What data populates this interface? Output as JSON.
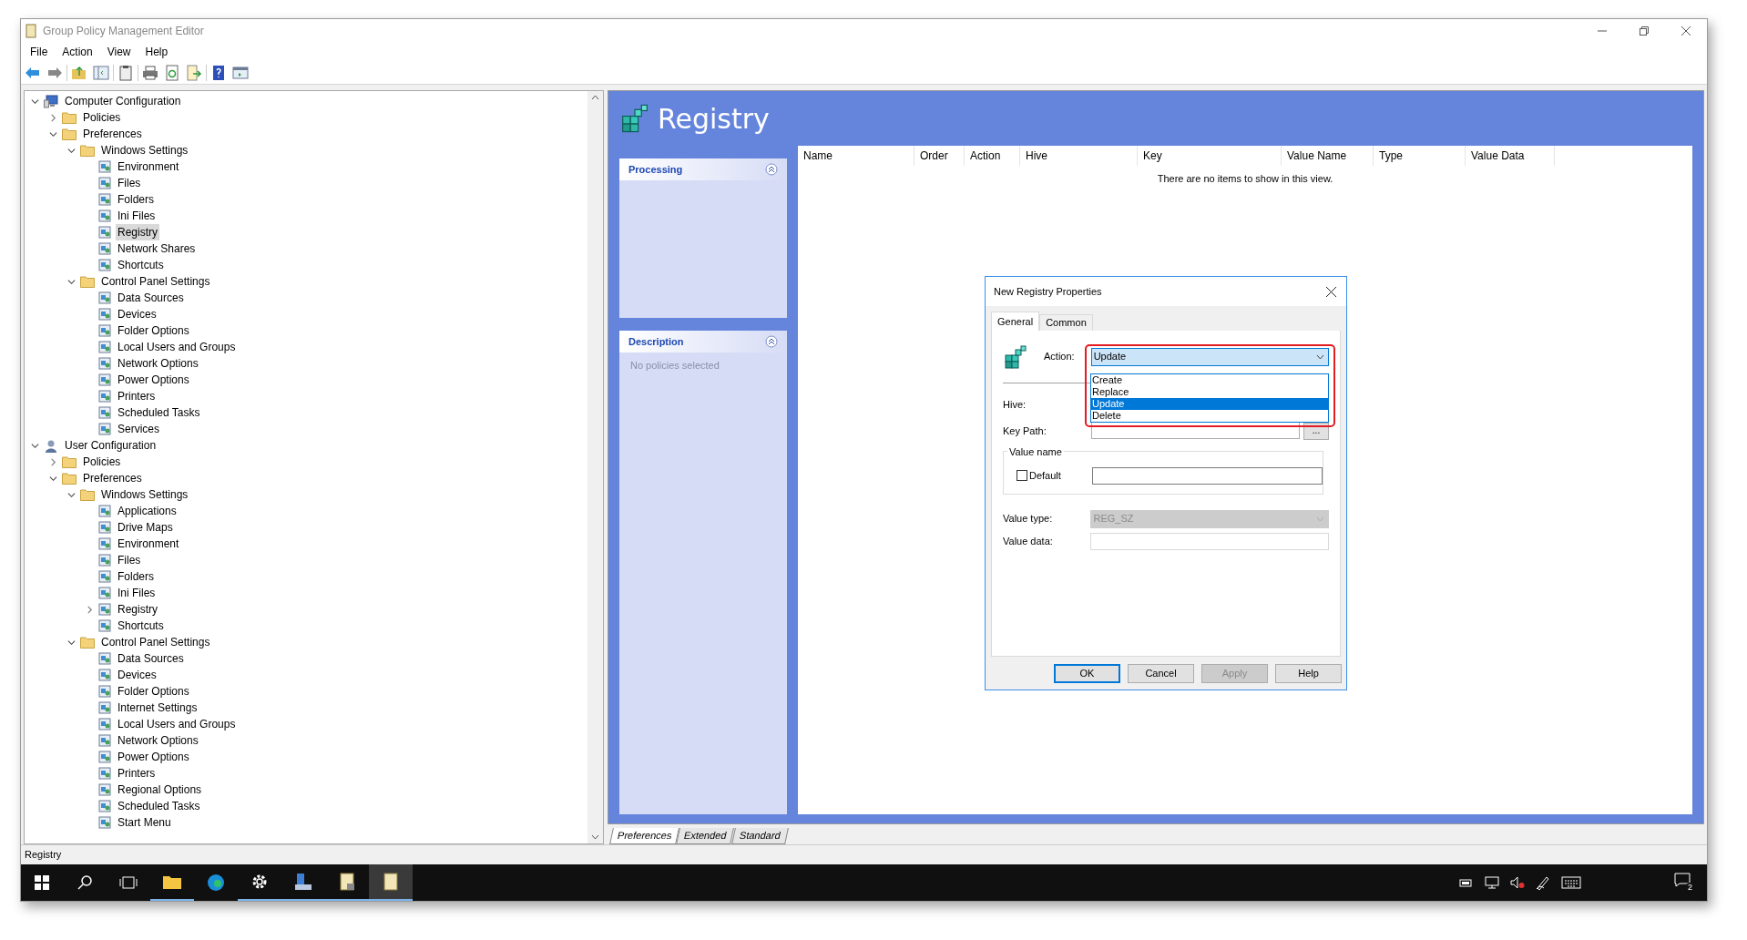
{
  "window": {
    "title": "Group Policy Management Editor"
  },
  "menu": [
    "File",
    "Action",
    "View",
    "Help"
  ],
  "tree": [
    {
      "label": "Computer Configuration",
      "expanded": true,
      "selected": false,
      "children": [
        {
          "label": "Policies",
          "expanded": false,
          "selected": false
        },
        {
          "label": "Preferences",
          "expanded": true,
          "selected": false,
          "children": [
            {
              "label": "Windows Settings",
              "expanded": true,
              "selected": false,
              "children": [
                {
                  "label": "Environment",
                  "selected": false
                },
                {
                  "label": "Files",
                  "selected": false
                },
                {
                  "label": "Folders",
                  "selected": false
                },
                {
                  "label": "Ini Files",
                  "selected": false
                },
                {
                  "label": "Registry",
                  "selected": true
                },
                {
                  "label": "Network Shares",
                  "selected": false
                },
                {
                  "label": "Shortcuts",
                  "selected": false
                }
              ]
            },
            {
              "label": "Control Panel Settings",
              "expanded": true,
              "selected": false,
              "children": [
                {
                  "label": "Data Sources",
                  "selected": false
                },
                {
                  "label": "Devices",
                  "selected": false
                },
                {
                  "label": "Folder Options",
                  "selected": false
                },
                {
                  "label": "Local Users and Groups",
                  "selected": false
                },
                {
                  "label": "Network Options",
                  "selected": false
                },
                {
                  "label": "Power Options",
                  "selected": false
                },
                {
                  "label": "Printers",
                  "selected": false
                },
                {
                  "label": "Scheduled Tasks",
                  "selected": false
                },
                {
                  "label": "Services",
                  "selected": false
                }
              ]
            }
          ]
        }
      ]
    },
    {
      "label": "User Configuration",
      "expanded": true,
      "selected": false,
      "children": [
        {
          "label": "Policies",
          "expanded": false,
          "selected": false
        },
        {
          "label": "Preferences",
          "expanded": true,
          "selected": false,
          "children": [
            {
              "label": "Windows Settings",
              "expanded": true,
              "selected": false,
              "children": [
                {
                  "label": "Applications",
                  "selected": false
                },
                {
                  "label": "Drive Maps",
                  "selected": false
                },
                {
                  "label": "Environment",
                  "selected": false
                },
                {
                  "label": "Files",
                  "selected": false
                },
                {
                  "label": "Folders",
                  "selected": false
                },
                {
                  "label": "Ini Files",
                  "selected": false
                },
                {
                  "label": "Registry",
                  "expanded": false,
                  "selected": false
                },
                {
                  "label": "Shortcuts",
                  "selected": false
                }
              ]
            },
            {
              "label": "Control Panel Settings",
              "expanded": true,
              "selected": false,
              "children": [
                {
                  "label": "Data Sources",
                  "selected": false
                },
                {
                  "label": "Devices",
                  "selected": false
                },
                {
                  "label": "Folder Options",
                  "selected": false
                },
                {
                  "label": "Internet Settings",
                  "selected": false
                },
                {
                  "label": "Local Users and Groups",
                  "selected": false
                },
                {
                  "label": "Network Options",
                  "selected": false
                },
                {
                  "label": "Power Options",
                  "selected": false
                },
                {
                  "label": "Printers",
                  "selected": false
                },
                {
                  "label": "Regional Options",
                  "selected": false
                },
                {
                  "label": "Scheduled Tasks",
                  "selected": false
                },
                {
                  "label": "Start Menu",
                  "selected": false
                }
              ]
            }
          ]
        }
      ]
    }
  ],
  "content": {
    "title": "Registry",
    "panels": [
      {
        "title": "Processing"
      },
      {
        "title": "Description",
        "text": "No policies selected"
      }
    ],
    "columns": [
      "Name",
      "Order",
      "Action",
      "Hive",
      "Key",
      "Value Name",
      "Type",
      "Value Data"
    ],
    "empty_text": "There are no items to show in this view."
  },
  "bottom_tabs": [
    {
      "label": "Preferences",
      "selected": true
    },
    {
      "label": "Extended",
      "selected": false
    },
    {
      "label": "Standard",
      "selected": false
    }
  ],
  "status_bar": "Registry",
  "taskbar": {
    "notification_count": "2"
  },
  "dialog": {
    "title": "New Registry Properties",
    "tabs": [
      {
        "label": "General",
        "selected": true
      },
      {
        "label": "Common",
        "selected": false
      }
    ],
    "action_label": "Action:",
    "action_value": "Update",
    "action_options": [
      {
        "label": "Create",
        "selected": false
      },
      {
        "label": "Replace",
        "selected": false
      },
      {
        "label": "Update",
        "selected": true
      },
      {
        "label": "Delete",
        "selected": false
      }
    ],
    "hive_label": "Hive:",
    "key_path_label": "Key Path:",
    "browse_button": "...",
    "value_name_group": "Value name",
    "default_label": "Default",
    "default_checked": false,
    "value_type_label": "Value type:",
    "value_type": "REG_SZ",
    "value_type_disabled": true,
    "value_data_label": "Value data:",
    "buttons": [
      {
        "label": "OK",
        "disabled": false,
        "default": true
      },
      {
        "label": "Cancel",
        "disabled": false,
        "default": false
      },
      {
        "label": "Apply",
        "disabled": true,
        "default": false
      },
      {
        "label": "Help",
        "disabled": false,
        "default": false
      }
    ]
  }
}
